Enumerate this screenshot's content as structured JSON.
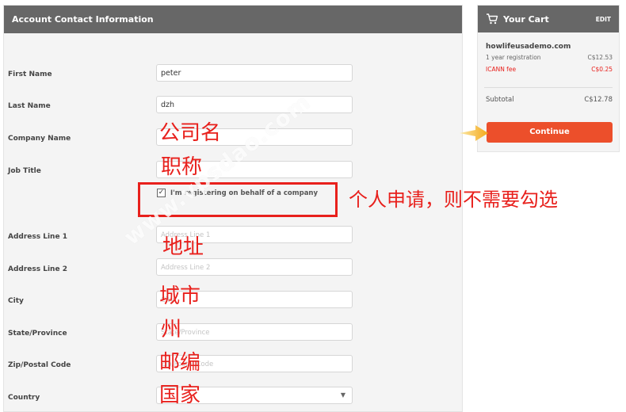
{
  "form": {
    "header_title": "Account Contact Information",
    "rows": [
      {
        "label": "First Name",
        "value": "peter"
      },
      {
        "label": "Last Name",
        "value": "dzh"
      },
      {
        "label": "Company Name",
        "value": ""
      },
      {
        "label": "Job Title",
        "value": ""
      },
      {
        "label": "Address Line 1",
        "placeholder": "Address Line 1"
      },
      {
        "label": "Address Line 2",
        "placeholder": "Address Line 2"
      },
      {
        "label": "City",
        "placeholder": "City"
      },
      {
        "label": "State/Province",
        "placeholder": "State/Province"
      },
      {
        "label": "Zip/Postal Code",
        "placeholder": "Zip/Postal Code"
      },
      {
        "label": "Country",
        "value": ""
      }
    ],
    "checkbox_label": "I'm registering on behalf of a company",
    "checkbox_checked_glyph": "✓"
  },
  "annotations": {
    "company_name": "公司名",
    "job_title": "职称",
    "checkbox_note": "个人申请，则不需要勾选",
    "address": "地址",
    "city": "城市",
    "state": "州",
    "zip": "邮编",
    "country": "国家",
    "color": "#e8201c"
  },
  "watermark": "www.vpsdao.com",
  "cart": {
    "title": "Your Cart",
    "edit_label": "EDIT",
    "domain": "howlifeusademo.com",
    "items": [
      {
        "label": "1 year registration",
        "price": "C$12.53"
      },
      {
        "label": "ICANN fee",
        "price": "C$0.25"
      }
    ],
    "subtotal_label": "Subtotal",
    "subtotal_value": "C$12.78",
    "continue_label": "Continue",
    "accent_color": "#ec4f2b"
  }
}
